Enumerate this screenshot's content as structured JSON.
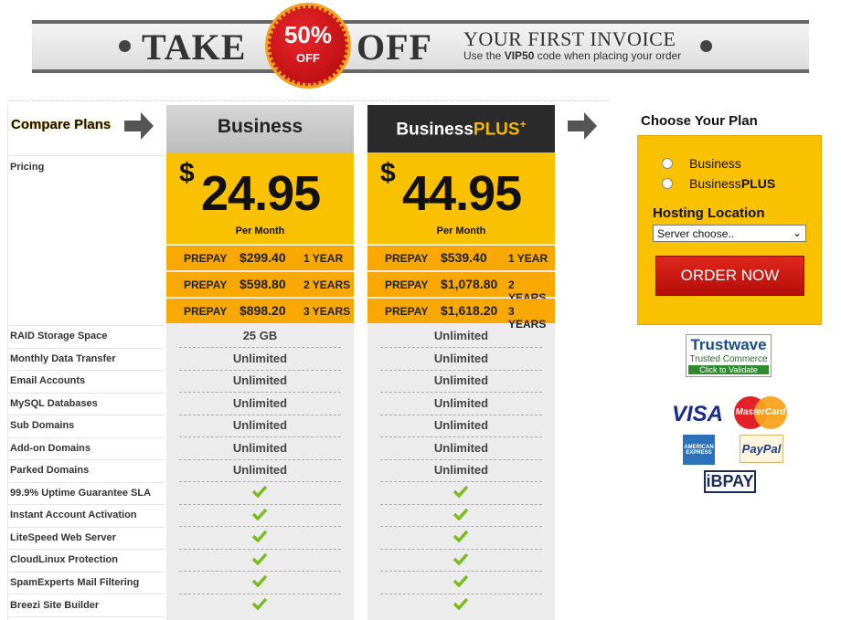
{
  "banner": {
    "take": "TAKE",
    "badge_percent": "50%",
    "badge_off": "OFF",
    "off": "OFF",
    "headline": "YOUR FIRST INVOICE",
    "sub_prefix": "Use the ",
    "sub_code": "VIP50",
    "sub_suffix": " code when placing your order"
  },
  "compare": {
    "title": "Compare Plans",
    "labels": [
      "Pricing",
      "RAID Storage Space",
      "Monthly Data Transfer",
      "Email Accounts",
      "MySQL Databases",
      "Sub Domains",
      "Add-on Domains",
      "Parked Domains",
      "99.9% Uptime Guarantee SLA",
      "Instant Account Activation",
      "LiteSpeed Web Server",
      "CloudLinux Protection",
      "SpamExperts Mail Filtering",
      "Breezi Site Builder"
    ]
  },
  "plans": [
    {
      "name": "Business",
      "currency": "$",
      "price": "24.95",
      "per": "Per Month",
      "prepay": [
        {
          "label": "PREPAY",
          "value": "$299.40",
          "term": "1 YEAR"
        },
        {
          "label": "PREPAY",
          "value": "$598.80",
          "term": "2 YEARS"
        },
        {
          "label": "PREPAY",
          "value": "$898.20",
          "term": "3 YEARS"
        }
      ],
      "features": [
        "25 GB",
        "Unlimited",
        "Unlimited",
        "Unlimited",
        "Unlimited",
        "Unlimited",
        "Unlimited"
      ],
      "checks": 6
    },
    {
      "name_main": "Business",
      "name_accent": "PLUS",
      "name_sup": "+",
      "currency": "$",
      "price": "44.95",
      "per": "Per Month",
      "prepay": [
        {
          "label": "PREPAY",
          "value": "$539.40",
          "term": "1 YEAR"
        },
        {
          "label": "PREPAY",
          "value": "$1,078.80",
          "term": "2 YEARS"
        },
        {
          "label": "PREPAY",
          "value": "$1,618.20",
          "term": "3 YEARS"
        }
      ],
      "features": [
        "Unlimited",
        "Unlimited",
        "Unlimited",
        "Unlimited",
        "Unlimited",
        "Unlimited",
        "Unlimited"
      ],
      "checks": 6
    }
  ],
  "choose": {
    "title": "Choose Your Plan",
    "option1": "Business",
    "option2_main": "Business",
    "option2_bold": "PLUS",
    "location_title": "Hosting Location",
    "select_value": "Server choose..",
    "order_button": "ORDER NOW"
  },
  "trust": {
    "brand": "Trustwave",
    "line": "Trusted Commerce",
    "validate": "Click to Validate"
  },
  "payments": {
    "visa": "VISA",
    "mastercard": "MasterCard",
    "amex": "AMERICAN EXPRESS",
    "paypal": "PayPal",
    "ipay": "iBPAY"
  },
  "colors": {
    "yellow": "#f9c100",
    "orange": "#f8a800",
    "red": "#c8160f",
    "dark": "#2b2b2b"
  }
}
